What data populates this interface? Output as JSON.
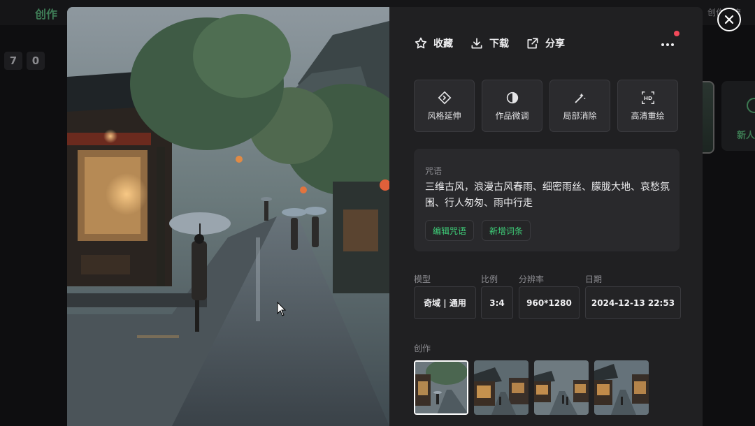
{
  "background": {
    "tab_label": "创作",
    "right_label": "创作交流",
    "counter": [
      "7",
      "0"
    ],
    "new_label": "新人"
  },
  "actions": {
    "favorite": "收藏",
    "download": "下载",
    "share": "分享"
  },
  "tools": [
    {
      "label": "风格延伸",
      "icon": "diamond-arrows-icon"
    },
    {
      "label": "作品微调",
      "icon": "half-circle-icon"
    },
    {
      "label": "局部消除",
      "icon": "magic-wand-icon"
    },
    {
      "label": "高清重绘",
      "icon": "hd-icon"
    }
  ],
  "prompt": {
    "label": "咒语",
    "text": "三维古风，浪漫古风春雨、细密雨丝、朦胧大地、哀愁氛围、行人匆匆、雨中行走",
    "edit_button": "编辑咒语",
    "add_button": "新增词条"
  },
  "meta": {
    "model_label": "模型",
    "model_value": "奇域 | 通用",
    "ratio_label": "比例",
    "ratio_value": "3:4",
    "resolution_label": "分辨率",
    "resolution_value": "960*1280",
    "date_label": "日期",
    "date_value": "2024-12-13 22:53"
  },
  "works": {
    "label": "创作",
    "count": 4,
    "selected_index": 0
  },
  "colors": {
    "accent_green": "#3fd17a",
    "notification_red": "#f2495a",
    "panel_bg": "#202022"
  }
}
